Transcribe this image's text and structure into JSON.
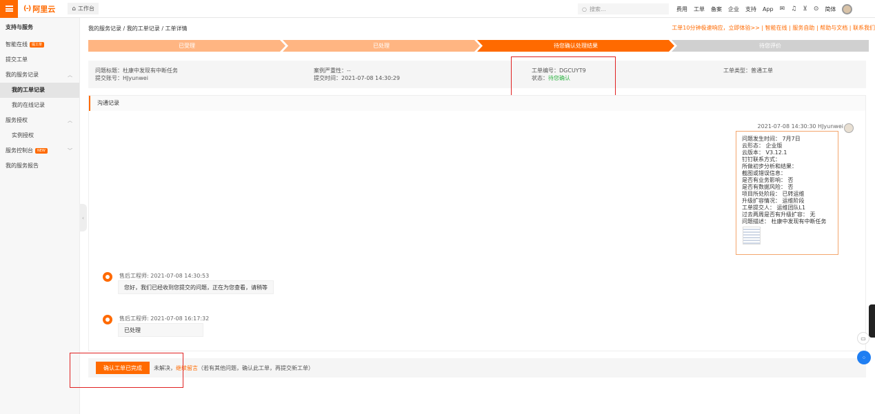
{
  "topbar": {
    "logo_mark": "(-)",
    "logo_text": "阿里云",
    "workbench": "工作台",
    "search_placeholder": "搜索...",
    "nav": [
      "费用",
      "工单",
      "备案",
      "企业",
      "支持",
      "App"
    ],
    "lang": "简体"
  },
  "sidebar": {
    "title": "支持与服务",
    "items": [
      {
        "label": "智能在线",
        "badge": "提工单"
      },
      {
        "label": "提交工单"
      },
      {
        "label": "我的服务记录"
      },
      {
        "label": "我的工单记录"
      },
      {
        "label": "我的在线记录"
      },
      {
        "label": "服务授权"
      },
      {
        "label": "实例授权"
      },
      {
        "label": "服务控制台",
        "badge": "NEW"
      },
      {
        "label": "我的服务报告"
      }
    ]
  },
  "breadcrumb": "我的服务记录 / 我的工单记录 / 工单详情",
  "quick_links": "工单10分钟极速响应，立即体验>> | 智能在线 | 服务自助 | 帮助与文档 | 联系我们",
  "steps": [
    "已受理",
    "已处理",
    "待您确认处理结果",
    "待您评价"
  ],
  "ticket": {
    "title_label": "问题标题：",
    "title": "杜康中发现有中断任务",
    "account_label": "提交账号：",
    "account": "HJyunwei",
    "severity_label": "案例严重性：",
    "severity": "--",
    "time_label": "提交时间：",
    "time": "2021-07-08 14:30:29",
    "id_label": "工单编号：",
    "id": "DGCUYT9",
    "status_label": "状态：",
    "status": "待您确认",
    "type_label": "工单类型：",
    "type": "普通工单"
  },
  "communication": {
    "header": "沟通记录",
    "user_meta": "2021-07-08 14:30:30   HJyunwei",
    "user_lines": [
      "问题发生时间： 7月7日",
      "云形态： 企业版",
      "云版本： V3.12.1",
      "钉钉联系方式：",
      "所做初步分析和结果：",
      "截图或错误信息：",
      "是否有业务影响： 否",
      "是否有数据风险： 否",
      "项目所处阶段： 已转运维",
      "升级扩容情况： 运维阶段",
      "工单提交人： 运维团队L1",
      "过去两周是否有升级扩容： 无",
      "问题描述： 杜康中发现有中断任务"
    ],
    "replies": [
      {
        "meta": "售后工程师:   2021-07-08 14:30:53",
        "text": "您好，我们已经收到您提交的问题，正在为您查看，请稍等"
      },
      {
        "meta": "售后工程师:   2021-07-08 16:17:32",
        "text": "已处理"
      }
    ]
  },
  "actions": {
    "confirm": "确认工单已完成",
    "unsolved": "未解决，",
    "continue": "继续留言",
    "note": "（若有其他问题，确认此工单，再提交新工单）"
  }
}
